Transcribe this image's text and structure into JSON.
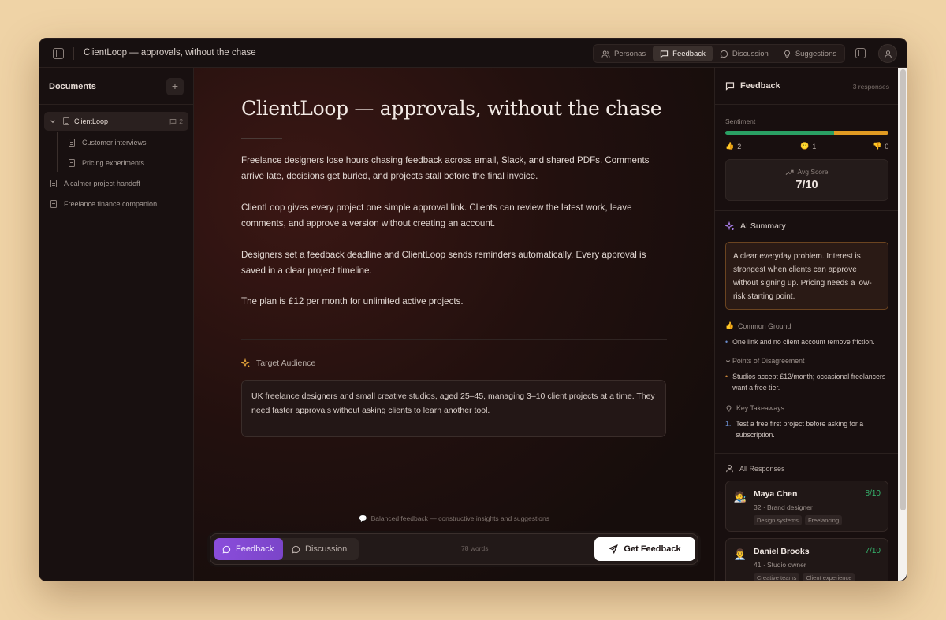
{
  "app": {
    "doc_title": "ClientLoop — approvals, without the chase"
  },
  "top_tabs": [
    {
      "label": "Personas",
      "icon": "users-icon",
      "active": false
    },
    {
      "label": "Feedback",
      "icon": "message-icon",
      "active": true
    },
    {
      "label": "Discussion",
      "icon": "chat-bubble-icon",
      "active": false
    },
    {
      "label": "Suggestions",
      "icon": "lightbulb-icon",
      "active": false
    }
  ],
  "sidebar": {
    "title": "Documents",
    "add_label": "+",
    "items": [
      {
        "label": "ClientLoop",
        "count": "2",
        "active": true
      },
      {
        "label": "Customer interviews"
      },
      {
        "label": "Pricing experiments"
      },
      {
        "label": "A calmer project handoff"
      },
      {
        "label": "Freelance finance companion"
      }
    ]
  },
  "main": {
    "title": "ClientLoop — approvals, without the chase",
    "paragraphs": [
      "Freelance designers lose hours chasing feedback across email, Slack, and shared PDFs. Comments arrive late, decisions get buried, and projects stall before the final invoice.",
      "ClientLoop gives every project one simple approval link. Clients can review the latest work, leave comments, and approve a version without creating an account.",
      "Designers set a feedback deadline and ClientLoop sends reminders automatically. Every approval is saved in a clear project timeline.",
      "The plan is £12 per month for unlimited active projects."
    ],
    "target_audience_label": "Target Audience",
    "target_audience_text": "UK freelance designers and small creative studios, aged 25–45, managing 3–10 client projects at a time. They need faster approvals without asking clients to learn another tool.",
    "hint": "Balanced feedback — constructive insights and suggestions",
    "mode_feedback": "Feedback",
    "mode_discussion": "Discussion",
    "word_count": "78 words",
    "get_feedback": "Get Feedback"
  },
  "feedback_panel": {
    "title": "Feedback",
    "responses_count": "3 responses",
    "sentiment_label": "Sentiment",
    "sentiment": {
      "positive": 2,
      "neutral": 1,
      "negative": 0
    },
    "sentiment_positive_text": "2",
    "sentiment_neutral_text": "1",
    "sentiment_negative_text": "0",
    "avg_score_label": "Avg Score",
    "avg_score": "7/10",
    "ai_summary_title": "AI Summary",
    "ai_summary": "A clear everyday problem. Interest is strongest when clients can approve without signing up. Pricing needs a low-risk starting point.",
    "common_ground_label": "Common Ground",
    "common_ground": [
      "One link and no client account remove friction."
    ],
    "disagreement_label": "Points of Disagreement",
    "disagreement": [
      "Studios accept £12/month; occasional freelancers want a free tier."
    ],
    "takeaways_label": "Key Takeaways",
    "takeaways": [
      {
        "num": "1.",
        "text": "Test a free first project before asking for a subscription."
      }
    ],
    "all_responses_label": "All Responses",
    "responses": [
      {
        "name": "Maya Chen",
        "score": "8/10",
        "sub": "32 · Brand designer",
        "tags": [
          "Design systems",
          "Freelancing"
        ]
      },
      {
        "name": "Daniel Brooks",
        "score": "7/10",
        "sub": "41 · Studio owner",
        "tags": [
          "Creative teams",
          "Client experience"
        ]
      }
    ]
  },
  "colors": {
    "accent_purple": "#8a4ddb",
    "sentiment_positive": "#2aa064",
    "sentiment_neutral": "#e09a22",
    "score_green": "#36b66e"
  }
}
